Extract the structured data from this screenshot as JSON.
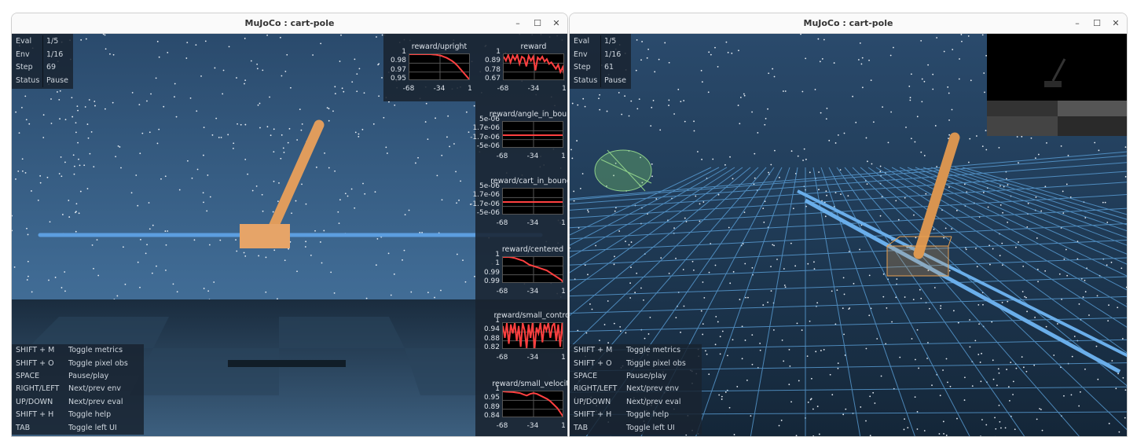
{
  "windows": [
    {
      "title": "MuJoCo : cart-pole",
      "info": [
        {
          "k": "Eval",
          "v": "1/5"
        },
        {
          "k": "Env",
          "v": "1/16"
        },
        {
          "k": "Step",
          "v": "69"
        },
        {
          "k": "Status",
          "v": "Pause"
        }
      ]
    },
    {
      "title": "MuJoCo : cart-pole",
      "info": [
        {
          "k": "Eval",
          "v": "1/5"
        },
        {
          "k": "Env",
          "v": "1/16"
        },
        {
          "k": "Step",
          "v": "61"
        },
        {
          "k": "Status",
          "v": "Pause"
        }
      ]
    }
  ],
  "window_controls": {
    "minimize": "–",
    "maximize": "☐",
    "close": "✕"
  },
  "help": [
    {
      "k": "SHIFT + M",
      "v": "Toggle metrics"
    },
    {
      "k": "SHIFT + O",
      "v": "Toggle pixel obs"
    },
    {
      "k": "SPACE",
      "v": "Pause/play"
    },
    {
      "k": "RIGHT/LEFT",
      "v": "Next/prev env"
    },
    {
      "k": "UP/DOWN",
      "v": "Next/prev eval"
    },
    {
      "k": "SHIFT + H",
      "v": "Toggle help"
    },
    {
      "k": "TAB",
      "v": "Toggle left UI"
    }
  ],
  "line_color": "#ff4040",
  "chart_data": [
    {
      "type": "line",
      "title": "reward/upright",
      "yticks": [
        "1",
        "0.98",
        "0.97",
        "0.95"
      ],
      "xticks": [
        "-68",
        "-34",
        "1"
      ],
      "xlim": [
        -68,
        1
      ],
      "ylim": [
        0.948,
        1
      ],
      "values": [
        1,
        1,
        1,
        1,
        1,
        1,
        1,
        1,
        1,
        0.9995,
        0.999,
        0.998,
        0.997,
        0.995,
        0.993,
        0.99,
        0.987,
        0.983,
        0.978,
        0.972,
        0.966,
        0.96,
        0.954,
        0.948
      ]
    },
    {
      "type": "line",
      "title": "reward",
      "yticks": [
        "1",
        "0.89",
        "0.78",
        "0.67"
      ],
      "xticks": [
        "-68",
        "-34",
        "1"
      ],
      "xlim": [
        -68,
        1
      ],
      "ylim": [
        0.67,
        1
      ],
      "values": [
        0.97,
        0.92,
        0.99,
        0.9,
        0.98,
        0.93,
        0.99,
        0.88,
        0.97,
        0.95,
        0.85,
        0.98,
        0.92,
        0.97,
        0.8,
        0.96,
        0.93,
        0.97,
        0.91,
        0.94,
        0.88,
        0.9,
        0.86,
        0.82,
        0.87,
        0.78,
        0.84,
        0.7
      ]
    },
    {
      "type": "line",
      "title": "reward/angle_in_bound",
      "yticks": [
        "5e-06",
        "1.7e-06",
        "-1.7e-06",
        "-5e-06"
      ],
      "xticks": [
        "-68",
        "-34",
        "1"
      ],
      "xlim": [
        -68,
        1
      ],
      "ylim": [
        -5e-06,
        5e-06
      ],
      "values": [
        0,
        0,
        0,
        0,
        0,
        0,
        0,
        0,
        0,
        0
      ]
    },
    {
      "type": "line",
      "title": "reward/cart_in_bounds",
      "yticks": [
        "5e-06",
        "1.7e-06",
        "-1.7e-06",
        "-5e-06"
      ],
      "xticks": [
        "-68",
        "-34",
        "1"
      ],
      "xlim": [
        -68,
        1
      ],
      "ylim": [
        -5e-06,
        5e-06
      ],
      "values": [
        0,
        0,
        0,
        0,
        0,
        0,
        0,
        0,
        0,
        0
      ]
    },
    {
      "type": "line",
      "title": "reward/centered",
      "yticks": [
        "1",
        "1",
        "0.99",
        "0.99"
      ],
      "xticks": [
        "-68",
        "-34",
        "1"
      ],
      "xlim": [
        -68,
        1
      ],
      "ylim": [
        0.986,
        1
      ],
      "values": [
        1,
        1,
        1,
        0.9998,
        0.9995,
        0.999,
        0.9985,
        0.998,
        0.997,
        0.996,
        0.9955,
        0.995,
        0.9945,
        0.994,
        0.9935,
        0.993,
        0.992,
        0.991,
        0.99,
        0.989,
        0.988,
        0.986
      ]
    },
    {
      "type": "line",
      "title": "reward/small_control",
      "yticks": [
        "1",
        "0.94",
        "0.88",
        "0.82"
      ],
      "xticks": [
        "-68",
        "-34",
        "1"
      ],
      "xlim": [
        -68,
        1
      ],
      "ylim": [
        0.82,
        1
      ],
      "values": [
        0.98,
        0.9,
        1,
        0.86,
        0.99,
        0.93,
        1,
        0.88,
        0.98,
        0.84,
        1,
        0.95,
        0.83,
        0.99,
        0.9,
        1,
        0.82,
        0.97,
        0.93,
        1,
        0.87,
        0.99,
        0.95,
        1,
        0.9,
        0.98,
        1,
        0.88,
        0.99,
        0.84,
        1,
        0.82
      ]
    },
    {
      "type": "line",
      "title": "reward/small_velocity",
      "yticks": [
        "1",
        "0.95",
        "0.89",
        "0.84"
      ],
      "xticks": [
        "-68",
        "-34",
        "1"
      ],
      "xlim": [
        -68,
        1
      ],
      "ylim": [
        0.84,
        1
      ],
      "values": [
        1,
        0.998,
        0.997,
        0.996,
        0.993,
        0.99,
        0.982,
        0.975,
        0.985,
        0.99,
        0.985,
        0.975,
        0.965,
        0.955,
        0.94,
        0.92,
        0.9,
        0.87,
        0.84
      ]
    }
  ]
}
